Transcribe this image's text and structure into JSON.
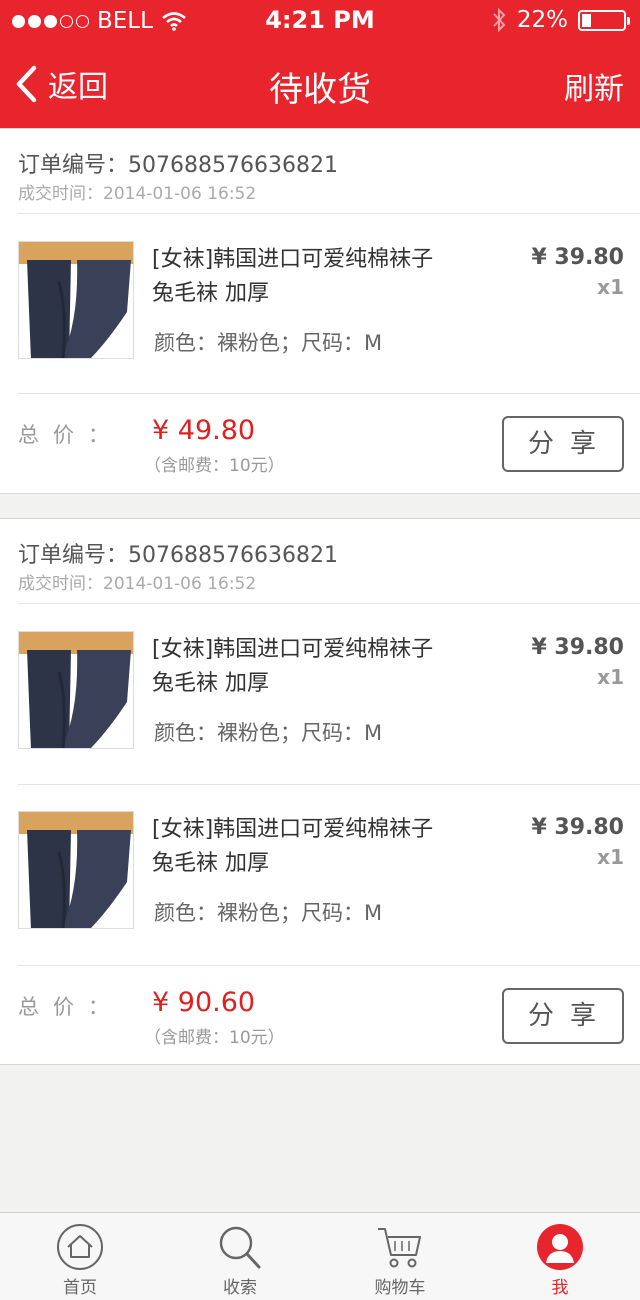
{
  "status": {
    "carrier": "BELL",
    "time": "4:21 PM",
    "battery": "22%",
    "battery_level": 0.22
  },
  "nav": {
    "back_label": "返回",
    "title": "待收货",
    "refresh_label": "刷新"
  },
  "labels": {
    "order_no": "订单编号：",
    "order_time": "成交时间：",
    "total": "总价：",
    "share": "分享"
  },
  "orders": [
    {
      "order_no": "507688576636821",
      "time": "2014-01-06  16:52",
      "items": [
        {
          "name_line1": "[女袜]韩国进口可爱纯棉袜子",
          "name_line2": "兔毛袜 加厚",
          "spec": "颜色：裸粉色；尺码：M",
          "price": "¥ 39.80",
          "qty": "x1"
        }
      ],
      "total": "¥ 49.80",
      "shipping": "（含邮费：10元）"
    },
    {
      "order_no": "507688576636821",
      "time": "2014-01-06  16:52",
      "items": [
        {
          "name_line1": "[女袜]韩国进口可爱纯棉袜子",
          "name_line2": "兔毛袜 加厚",
          "spec": "颜色：裸粉色；尺码：M",
          "price": "¥ 39.80",
          "qty": "x1"
        },
        {
          "name_line1": "[女袜]韩国进口可爱纯棉袜子",
          "name_line2": "兔毛袜 加厚",
          "spec": "颜色：裸粉色；尺码：M",
          "price": "¥ 39.80",
          "qty": "x1"
        }
      ],
      "total": "¥ 90.60",
      "shipping": "（含邮费：10元）"
    }
  ],
  "tabs": [
    {
      "label": "首页",
      "icon": "home-icon"
    },
    {
      "label": "收索",
      "icon": "search-icon"
    },
    {
      "label": "购物车",
      "icon": "cart-icon"
    },
    {
      "label": "我",
      "icon": "user-icon",
      "active": true
    }
  ],
  "colors": {
    "accent": "#e8252d",
    "price": "#e02020",
    "background": "#f2f2f0"
  }
}
